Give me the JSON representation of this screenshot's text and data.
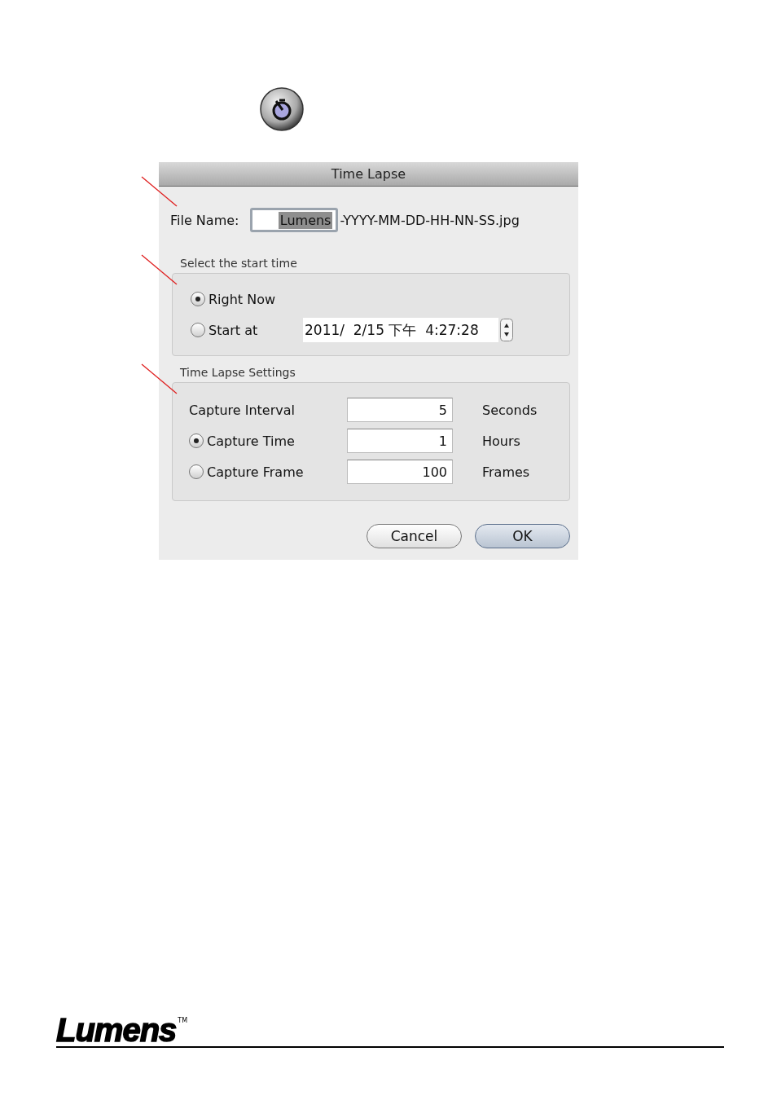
{
  "dialog": {
    "title": "Time Lapse",
    "file_name": {
      "label": "File Name:",
      "value": "Lumens",
      "text_selected": true,
      "suffix": "-YYYY-MM-DD-HH-NN-SS.jpg"
    },
    "start_time": {
      "title": "Select the start time",
      "options": [
        {
          "label": "Right Now",
          "selected": true
        },
        {
          "label": "Start at",
          "selected": false
        }
      ],
      "datetime": "2011/  2/15 下午  4:27:28"
    },
    "settings": {
      "title": "Time Lapse Settings",
      "interval": {
        "label": "Capture Interval",
        "value": "5",
        "unit": "Seconds"
      },
      "options": [
        {
          "label": "Capture Time",
          "value": "1",
          "unit": "Hours",
          "selected": true
        },
        {
          "label": "Capture Frame",
          "value": "100",
          "unit": "Frames",
          "selected": false
        }
      ]
    },
    "buttons": [
      {
        "label": "Cancel",
        "default": false
      },
      {
        "label": "OK",
        "default": true
      }
    ]
  },
  "footer": {
    "logo": "Lumens",
    "trademark": "TM"
  }
}
